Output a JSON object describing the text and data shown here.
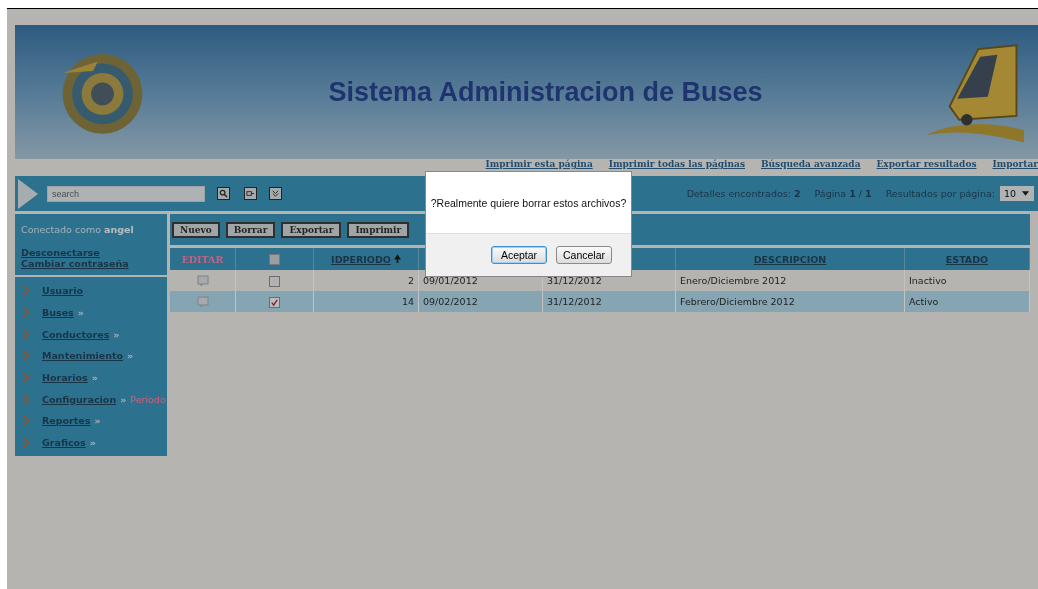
{
  "header": {
    "title": "Sistema Administracion de Buses"
  },
  "top_links": [
    "Imprimir esta página",
    "Imprimir todas las páginas",
    "Búsqueda avanzada",
    "Exportar resultados",
    "Importar"
  ],
  "toolbar": {
    "search": {
      "placeholder": "search"
    },
    "found": "Detalles encontrados: **2**",
    "page": "Página **1** / **1**",
    "per_page_label": "Resultados por página:",
    "per_page": "10"
  },
  "sidebar": {
    "user": "Conectado como **angel**",
    "account_links": [
      "Desconectarse",
      "Cambiar contraseña"
    ],
    "menu": [
      {
        "label": "Usuario"
      },
      {
        "label": "Buses",
        "marker": "»"
      },
      {
        "label": "Conductores",
        "marker": "»"
      },
      {
        "label": "Mantenimiento",
        "marker": "»"
      },
      {
        "label": "Horarios",
        "marker": "»"
      },
      {
        "label": "Configuracion",
        "marker": "»",
        "current": "Periodo"
      },
      {
        "label": "Reportes",
        "marker": "»"
      },
      {
        "label": "Graficos",
        "marker": "»"
      }
    ]
  },
  "actions": [
    "Nuevo",
    "Borrar",
    "Exportar",
    "Imprimir"
  ],
  "table": {
    "edit_header": "EDITAR",
    "select_all_checked": false,
    "columns": [
      {
        "label": "IDPERIODO",
        "sorted": true
      },
      {
        "label": "DESCRIPCION",
        "sorted": false
      },
      {
        "label": "ESTADO",
        "sorted": false
      }
    ],
    "rows": [
      {
        "selected": false,
        "checked": false,
        "idperiodo": "2",
        "column_4": "09/01/2012",
        "column_5": "31/12/2012",
        "descripcion": "Enero/Diciembre 2012",
        "estado": "Inactivo"
      },
      {
        "selected": true,
        "checked": true,
        "idperiodo": "14",
        "column_4": "09/02/2012",
        "column_5": "31/12/2012",
        "descripcion": "Febrero/Diciembre 2012",
        "estado": "Activo"
      }
    ]
  },
  "dialog": {
    "message": "?Realmente quiere borrar estos archivos?",
    "buttons": [
      {
        "label": "Aceptar",
        "focused": true
      },
      {
        "label": "Cancelar",
        "focused": false
      }
    ]
  }
}
